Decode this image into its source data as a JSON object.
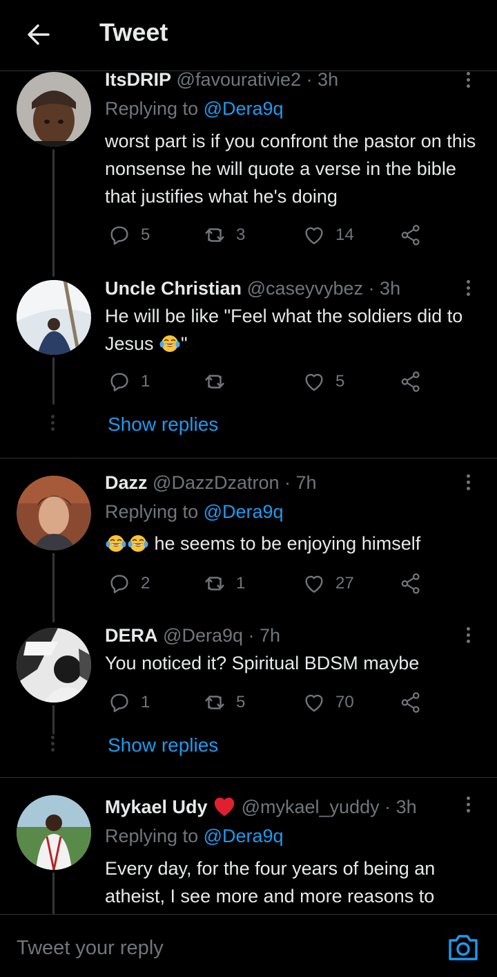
{
  "header": {
    "title": "Tweet"
  },
  "tweets": [
    {
      "name": "ItsDRIP",
      "handle": "@favourativie2",
      "time": "· 3h",
      "replying_prefix": "Replying to ",
      "replying_to": "@Dera9q",
      "text": "worst part is if you confront the pastor on this nonsense he will quote a verse in the bible that justifies what he's doing",
      "replies": "5",
      "retweets": "3",
      "likes": "14"
    },
    {
      "name": "Uncle Christian",
      "handle": "@caseyvybez",
      "time": "· 3h",
      "text_before": "He will be like \"Feel what the soldiers did to Jesus ",
      "text_after": "\"",
      "emoji": "face-with-tears-of-joy",
      "replies": "1",
      "retweets": "",
      "likes": "5",
      "show_replies": "Show replies"
    },
    {
      "name": "Dazz",
      "handle": "@DazzDzatron",
      "time": "· 7h",
      "replying_prefix": "Replying to ",
      "replying_to": "@Dera9q",
      "text": " he seems to be enjoying himself",
      "emoji": "face-with-tears-of-joy",
      "replies": "2",
      "retweets": "1",
      "likes": "27"
    },
    {
      "name": "DERA",
      "handle": "@Dera9q",
      "time": "· 7h",
      "text": "You noticed it? Spiritual BDSM maybe",
      "replies": "1",
      "retweets": "5",
      "likes": "70",
      "show_replies": "Show replies"
    },
    {
      "name": "Mykael Udy",
      "handle": "@mykael_yuddy",
      "time": "· 3h",
      "name_emoji": "red-heart",
      "replying_prefix": "Replying to ",
      "replying_to": "@Dera9q",
      "text": "Every day, for the four years of being an atheist, I see more and more reasons to"
    }
  ],
  "composer": {
    "placeholder": "Tweet your reply"
  },
  "colors": {
    "background": "#000000",
    "link": "#1d9bf0",
    "muted": "#71767b",
    "text": "#e7e9ea",
    "divider": "#2f3336"
  }
}
